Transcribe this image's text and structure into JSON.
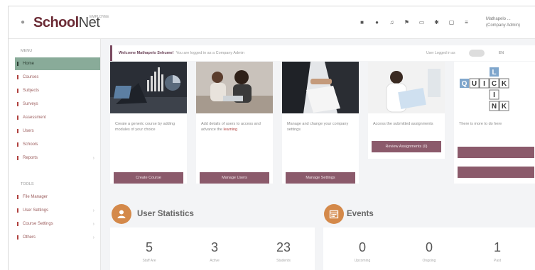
{
  "header": {
    "logo_part1": "School",
    "logo_part2": "Net",
    "logo_sup": "EMPLOYEE",
    "user_name": "Mathapelo ...",
    "user_role": "(Company Admin)"
  },
  "sidebar": {
    "section_menu": "MENU",
    "items": [
      {
        "label": "Home",
        "active": true
      },
      {
        "label": "Courses"
      },
      {
        "label": "Subjects"
      },
      {
        "label": "Surveys"
      },
      {
        "label": "Assessment"
      },
      {
        "label": "Users"
      },
      {
        "label": "Schools"
      },
      {
        "label": "Reports",
        "has_children": true
      }
    ],
    "section_tools": "TOOLS",
    "tools": [
      {
        "label": "File Manager"
      },
      {
        "label": "User Settings",
        "has_children": true
      },
      {
        "label": "Course Settings",
        "has_children": true
      },
      {
        "label": "Others",
        "has_children": true
      }
    ]
  },
  "welcome": {
    "greeting": "Welcome Mathapelo Sehume!",
    "role_text": "You are logged in as a Company Admin",
    "login_text": "User Logged in as",
    "language": "EN"
  },
  "cards": [
    {
      "desc": "Create a generic course by adding modules of your choice",
      "button": "Create Course"
    },
    {
      "desc": "Add details of users to access and advance the",
      "desc_link": "learning",
      "button": "Manage Users"
    },
    {
      "desc": "Manage and change your company settings",
      "button": "Manage Settings"
    },
    {
      "desc": "Access the submitted assignments",
      "button": "Review Assignments (0)"
    },
    {
      "desc": "There is more to do here",
      "button": ""
    }
  ],
  "quick_link_tiles": [
    "Q",
    "U",
    "I",
    "C",
    "K",
    "L",
    "I",
    "N",
    "K"
  ],
  "user_statistics": {
    "title": "User Statistics",
    "values": [
      "5",
      "3",
      "23"
    ],
    "labels": [
      "Staff Are",
      "Active",
      "Students"
    ]
  },
  "events": {
    "title": "Events",
    "values": [
      "0",
      "0",
      "1"
    ],
    "labels": [
      "Upcoming",
      "Ongoing",
      "Past"
    ]
  },
  "colors": {
    "accent": "#8b5a6b",
    "active_nav": "#89ab99",
    "stat_icon": "#d4894a",
    "brand": "#6b2b35"
  }
}
